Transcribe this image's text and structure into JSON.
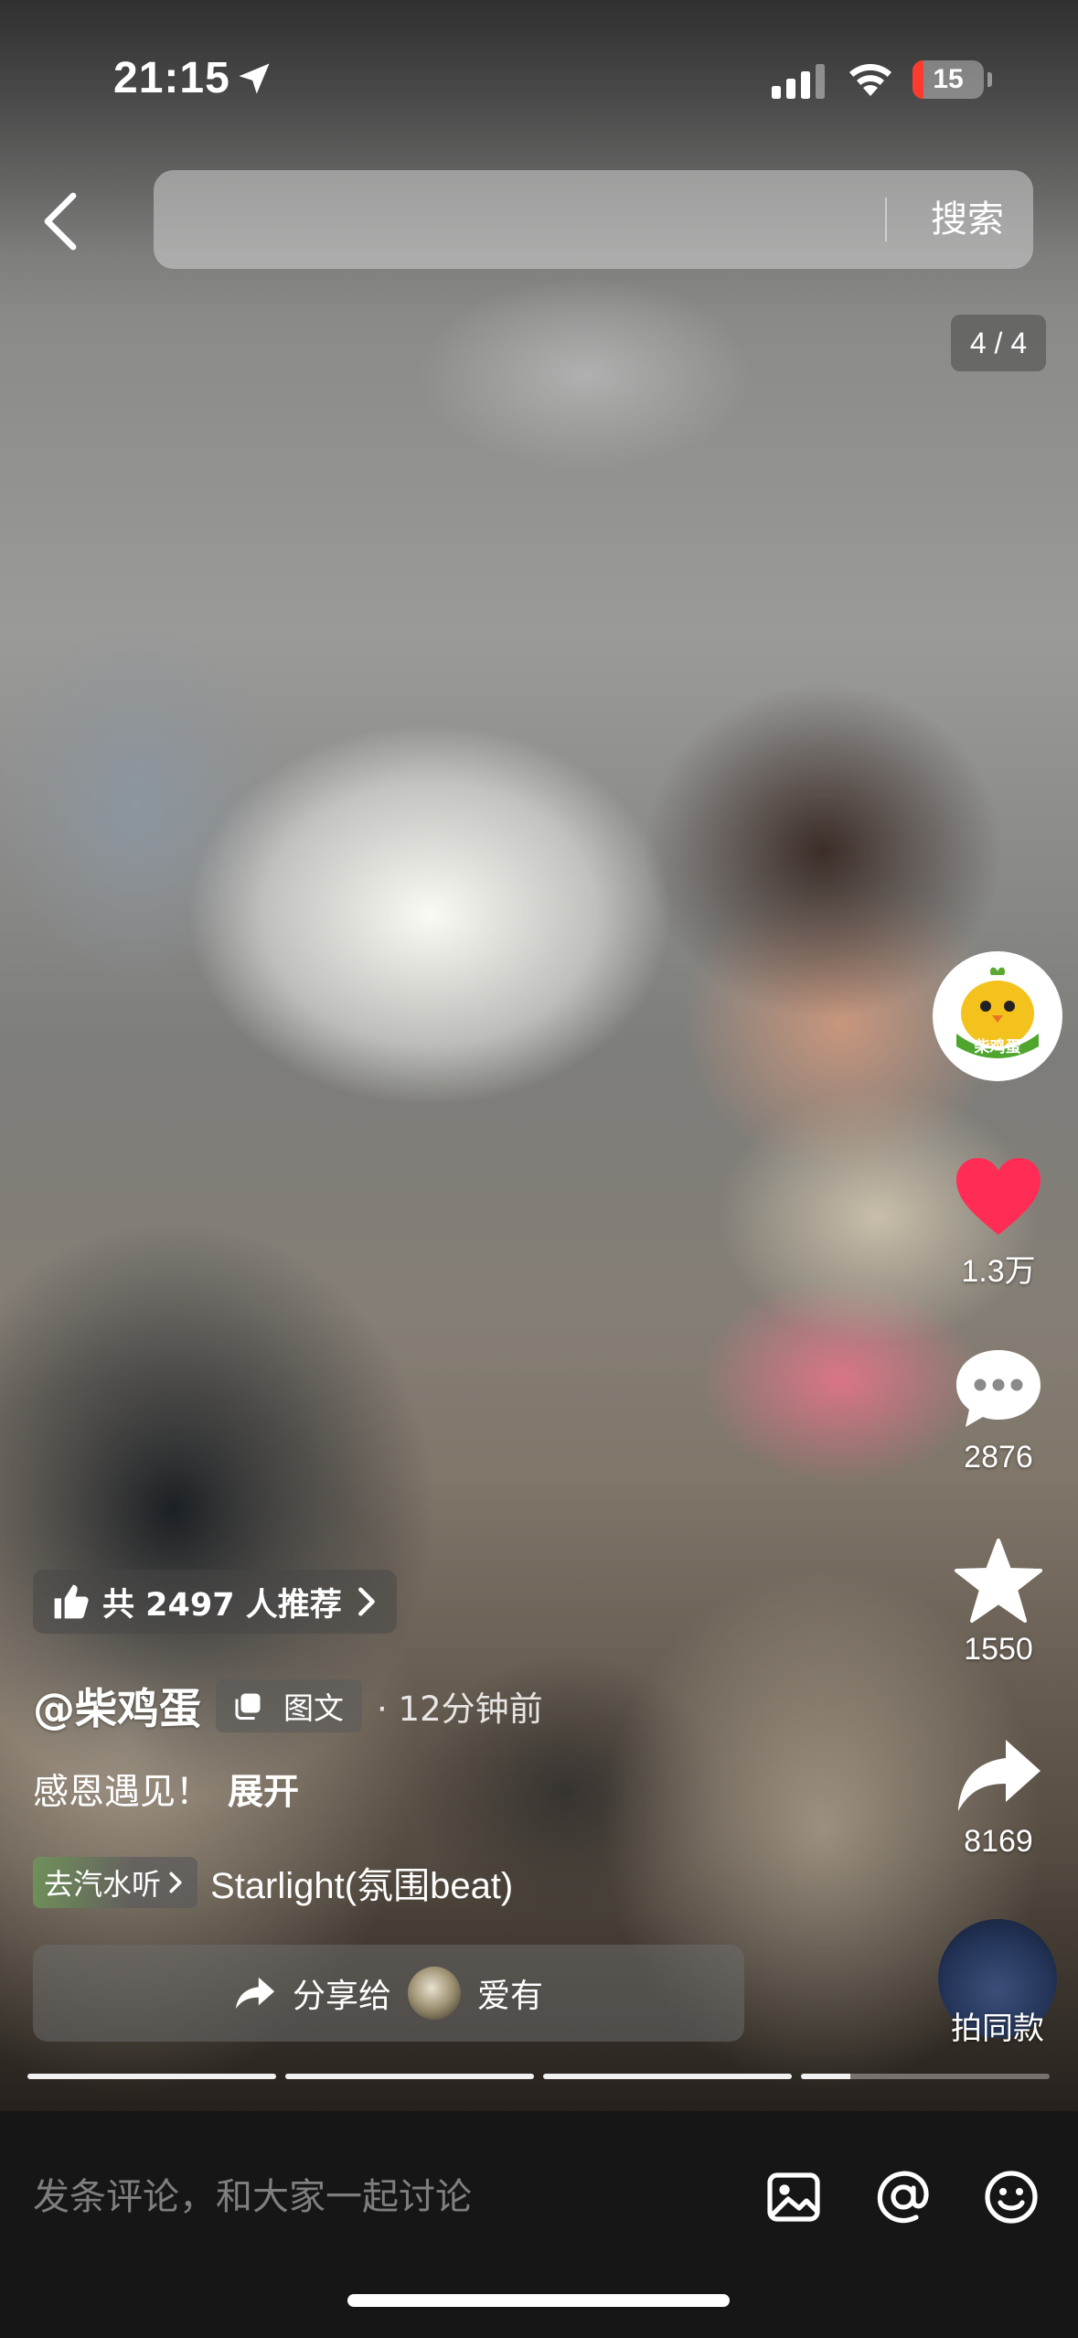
{
  "status_bar": {
    "time": "21:15",
    "battery_level": "15",
    "battery_color": "#ff3b30"
  },
  "top_bar": {
    "search_button": "搜索",
    "page_counter": "4 / 4",
    "back_icon": "chevron-left-icon"
  },
  "actions": {
    "avatar_text": "柴鸡蛋",
    "like_count": "1.3万",
    "like_color": "#ff2d55",
    "comment_count": "2876",
    "favorite_count": "1550",
    "share_count": "8169",
    "same_style_label": "拍同款"
  },
  "post": {
    "recommend_text": "共 2497 人推荐",
    "author": "@柴鸡蛋",
    "type_badge": "图文",
    "time_ago": "· 12分钟前",
    "caption": "感恩遇见！",
    "expand_label": "展开",
    "listen_label": "去汽水听",
    "song_title": "Starlight(氛围beat)",
    "share_to_label": "分享给",
    "friend_name": "爱有"
  },
  "gallery": {
    "current_page": 4,
    "total_pages": 4,
    "segments": [
      1,
      1,
      1,
      0.2
    ]
  },
  "comment_bar": {
    "placeholder": "发条评论，和大家一起讨论",
    "icons": [
      "image-icon",
      "at-icon",
      "emoji-icon"
    ]
  }
}
